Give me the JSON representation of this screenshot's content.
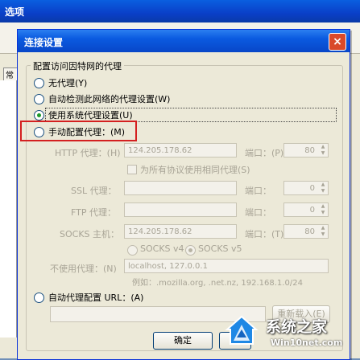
{
  "background_window": {
    "title": "选项",
    "tab_label": "常"
  },
  "dialog": {
    "title": "连接设置",
    "group_label": "配置访问因特网的代理",
    "options": {
      "no_proxy": "无代理(Y)",
      "auto_detect": "自动检测此网络的代理设置(W)",
      "system_proxy": "使用系统代理设置(U)",
      "manual_proxy": "手动配置代理：(M)",
      "auto_url": "自动代理配置 URL：(A)"
    },
    "manual": {
      "http_label": "HTTP 代理：(H)",
      "http_value": "124.205.178.62",
      "http_port_label": "端口：(P)",
      "http_port_value": "80",
      "same_proxy": "为所有协议使用相同代理(S)",
      "ssl_label": "SSL 代理：",
      "ssl_port_label": "端口：",
      "ssl_port_value": "0",
      "ftp_label": "FTP 代理：",
      "ftp_port_label": "端口：",
      "ftp_port_value": "0",
      "socks_label": "SOCKS 主机：",
      "socks_value": "124.205.178.62",
      "socks_port_label": "端口：(T)",
      "socks_port_value": "80",
      "socks_v4": "SOCKS v4",
      "socks_v5": "SOCKS v5",
      "no_proxy_label": "不使用代理：(N)",
      "no_proxy_value": "localhost, 127.0.0.1",
      "example": "例如：.mozilla.org, .net.nz, 192.168.1.0/24"
    },
    "reload_button": "重新载入(E)",
    "ok_button": "确定",
    "close_icon": "close-icon"
  },
  "watermark": {
    "brand": "系统之家",
    "url": "Win10net.com"
  }
}
